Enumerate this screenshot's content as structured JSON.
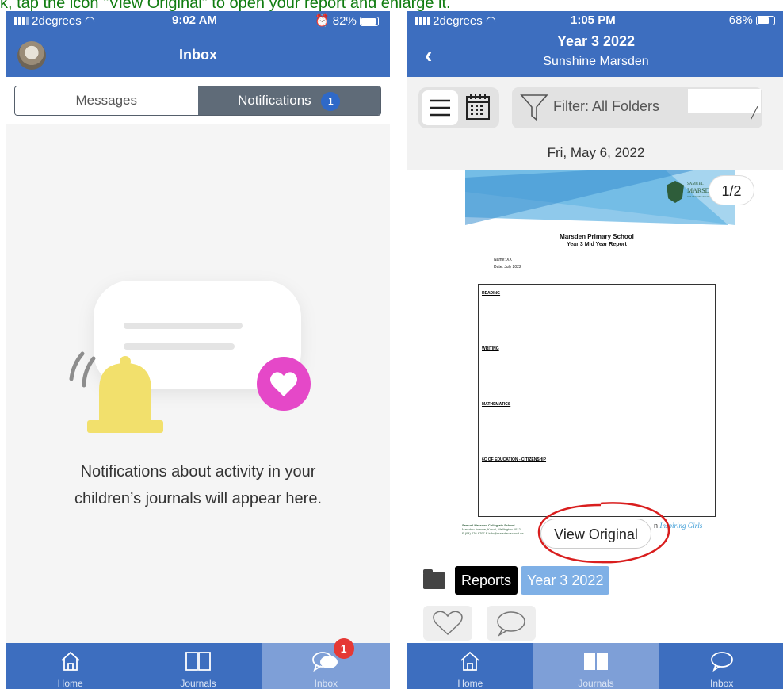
{
  "caption": "k, tap the icon \"View Original\" to open your report and enlarge it.",
  "left": {
    "status": {
      "carrier": "2degrees",
      "time": "9:02 AM",
      "battery": "82%"
    },
    "title": "Inbox",
    "segments": {
      "messages": "Messages",
      "notifications": "Notifications",
      "notifications_count": "1"
    },
    "empty_text_1": "Notifications about activity in your",
    "empty_text_2": "children’s journals will appear here.",
    "tabs": [
      {
        "label": "Home",
        "icon": "home-icon"
      },
      {
        "label": "Journals",
        "icon": "book-icon"
      },
      {
        "label": "Inbox",
        "icon": "chat-icon",
        "badge": "1"
      }
    ],
    "active_tab": "Inbox"
  },
  "right": {
    "status": {
      "carrier": "2degrees",
      "time": "1:05 PM",
      "battery": "68%"
    },
    "title": "Year 3 2022",
    "subtitle": "Sunshine Marsden",
    "filter": "Filter: All Folders",
    "date": "Fri, May 6, 2022",
    "page_indicator": "1/2",
    "report": {
      "school": "Marsden Primary School",
      "report_title": "Year 3 Mid Year Report",
      "name_line": "Name: XX",
      "date_line": "Date: July 2022",
      "sections": [
        "READING",
        "WRITING",
        "MATHEMATICS",
        "6C OF EDUCATION - CITIZENSHIP"
      ],
      "footer_school": "Samuel Marsden Collegiate School",
      "footer_address": "Marsden Avenue, Karori, Wellington 6012",
      "footer_contact": "P (04) 476 8707 E info@marsden.school.nz",
      "logo_text_1": "SAMUEL",
      "logo_text_2": "MARSDEN",
      "logo_text_3": "COLLEGIATE SCHOOL",
      "tagline_start": "n",
      "tagline": "Inspiring Girls"
    },
    "view_original": "View Original",
    "tags": {
      "folder": "Reports",
      "journal": "Year 3 2022"
    },
    "tabs": [
      {
        "label": "Home",
        "icon": "home-icon"
      },
      {
        "label": "Journals",
        "icon": "book-icon"
      },
      {
        "label": "Inbox",
        "icon": "chat-icon"
      }
    ],
    "active_tab": "Journals",
    "colors": {
      "header": "#3d6ebf",
      "active_tab": "#7e9fd7",
      "badge": "#e53935",
      "heart": "#e548c8",
      "bell": "#f2e06c",
      "highlight_circle": "#d91e1e"
    }
  }
}
